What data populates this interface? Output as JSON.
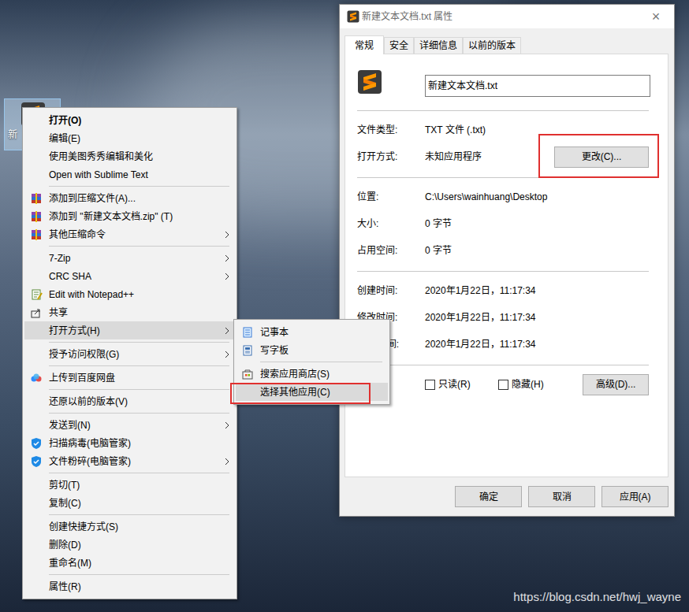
{
  "desktop": {
    "icon_label": "新",
    "icon_selected": true,
    "watermark": "https://blog.csdn.net/hwj_wayne"
  },
  "context_menu": {
    "groups": [
      [
        {
          "label": "打开(O)",
          "kind": "plain",
          "default": true,
          "submenu": false,
          "selected": false
        },
        {
          "label": "编辑(E)",
          "kind": "plain",
          "default": false,
          "submenu": false,
          "selected": false
        },
        {
          "label": "使用美图秀秀编辑和美化",
          "kind": "plain",
          "default": false,
          "submenu": false,
          "selected": false
        },
        {
          "label": "Open with Sublime Text",
          "kind": "plain",
          "default": false,
          "submenu": false,
          "selected": false
        }
      ],
      [
        {
          "label": "添加到压缩文件(A)...",
          "kind": "rar",
          "default": false,
          "submenu": false,
          "selected": false
        },
        {
          "label": "添加到 \"新建文本文档.zip\" (T)",
          "kind": "rar",
          "default": false,
          "submenu": false,
          "selected": false
        },
        {
          "label": "其他压缩命令",
          "kind": "rar",
          "default": false,
          "submenu": true,
          "selected": false
        }
      ],
      [
        {
          "label": "7-Zip",
          "kind": "plain",
          "default": false,
          "submenu": true,
          "selected": false
        },
        {
          "label": "CRC SHA",
          "kind": "plain",
          "default": false,
          "submenu": true,
          "selected": false
        },
        {
          "label": "Edit with Notepad++",
          "kind": "notepadpp",
          "default": false,
          "submenu": false,
          "selected": false
        },
        {
          "label": "共享",
          "kind": "share",
          "default": false,
          "submenu": false,
          "selected": false
        },
        {
          "label": "打开方式(H)",
          "kind": "plain",
          "default": false,
          "submenu": true,
          "selected": true
        }
      ],
      [
        {
          "label": "授予访问权限(G)",
          "kind": "plain",
          "default": false,
          "submenu": true,
          "selected": false
        }
      ],
      [
        {
          "label": "上传到百度网盘",
          "kind": "baidu",
          "default": false,
          "submenu": false,
          "selected": false
        }
      ],
      [
        {
          "label": "还原以前的版本(V)",
          "kind": "plain",
          "default": false,
          "submenu": false,
          "selected": false
        }
      ],
      [
        {
          "label": "发送到(N)",
          "kind": "plain",
          "default": false,
          "submenu": true,
          "selected": false
        },
        {
          "label": "扫描病毒(电脑管家)",
          "kind": "shield",
          "default": false,
          "submenu": false,
          "selected": false
        },
        {
          "label": "文件粉碎(电脑管家)",
          "kind": "shield",
          "default": false,
          "submenu": true,
          "selected": false
        }
      ],
      [
        {
          "label": "剪切(T)",
          "kind": "plain",
          "default": false,
          "submenu": false,
          "selected": false
        },
        {
          "label": "复制(C)",
          "kind": "plain",
          "default": false,
          "submenu": false,
          "selected": false
        }
      ],
      [
        {
          "label": "创建快捷方式(S)",
          "kind": "plain",
          "default": false,
          "submenu": false,
          "selected": false
        },
        {
          "label": "删除(D)",
          "kind": "plain",
          "default": false,
          "submenu": false,
          "selected": false
        },
        {
          "label": "重命名(M)",
          "kind": "plain",
          "default": false,
          "submenu": false,
          "selected": false
        }
      ],
      [
        {
          "label": "属性(R)",
          "kind": "plain",
          "default": false,
          "submenu": false,
          "selected": false
        }
      ]
    ]
  },
  "open_with_menu": {
    "groups": [
      [
        {
          "label": "记事本",
          "kind": "notepad",
          "selected": false
        },
        {
          "label": "写字板",
          "kind": "wordpad",
          "selected": false
        }
      ],
      [
        {
          "label": "搜索应用商店(S)",
          "kind": "store",
          "selected": false
        },
        {
          "label": "选择其他应用(C)",
          "kind": "plain",
          "selected": true
        }
      ]
    ]
  },
  "dialog": {
    "title": "新建文本文档.txt 属性",
    "close": "×",
    "tabs": [
      {
        "label": "常规",
        "selected": true
      },
      {
        "label": "安全",
        "selected": false
      },
      {
        "label": "详细信息",
        "selected": false
      },
      {
        "label": "以前的版本",
        "selected": false
      }
    ],
    "file_name": "新建文本文档.txt",
    "info_groups": [
      [
        {
          "label": "文件类型:",
          "value": "TXT 文件 (.txt)",
          "button": "",
          "clipped": false
        },
        {
          "label": "打开方式:",
          "value": "未知应用程序",
          "button": "更改(C)...",
          "clipped": false
        }
      ],
      [
        {
          "label": "位置:",
          "value": "C:\\Users\\wainhuang\\Desktop",
          "button": "",
          "clipped": false
        },
        {
          "label": "大小:",
          "value": "0 字节",
          "button": "",
          "clipped": false
        },
        {
          "label": "占用空间:",
          "value": "0 字节",
          "button": "",
          "clipped": false
        }
      ],
      [
        {
          "label": "创建时间:",
          "value": "2020年1月22日，11:17:34",
          "button": "",
          "clipped": false
        },
        {
          "label": "修改时间:",
          "value": "2020年1月22日，11:17:34",
          "button": "",
          "clipped": false
        },
        {
          "label": "间:",
          "value": "2020年1月22日，11:17:34",
          "button": "",
          "clipped": true
        }
      ]
    ],
    "attributes": {
      "checkboxes": [
        {
          "label": "只读(R)",
          "checked": false
        },
        {
          "label": "隐藏(H)",
          "checked": false
        }
      ],
      "button": "高级(D)..."
    },
    "buttons": [
      "确定",
      "取消",
      "应用(A)"
    ]
  }
}
